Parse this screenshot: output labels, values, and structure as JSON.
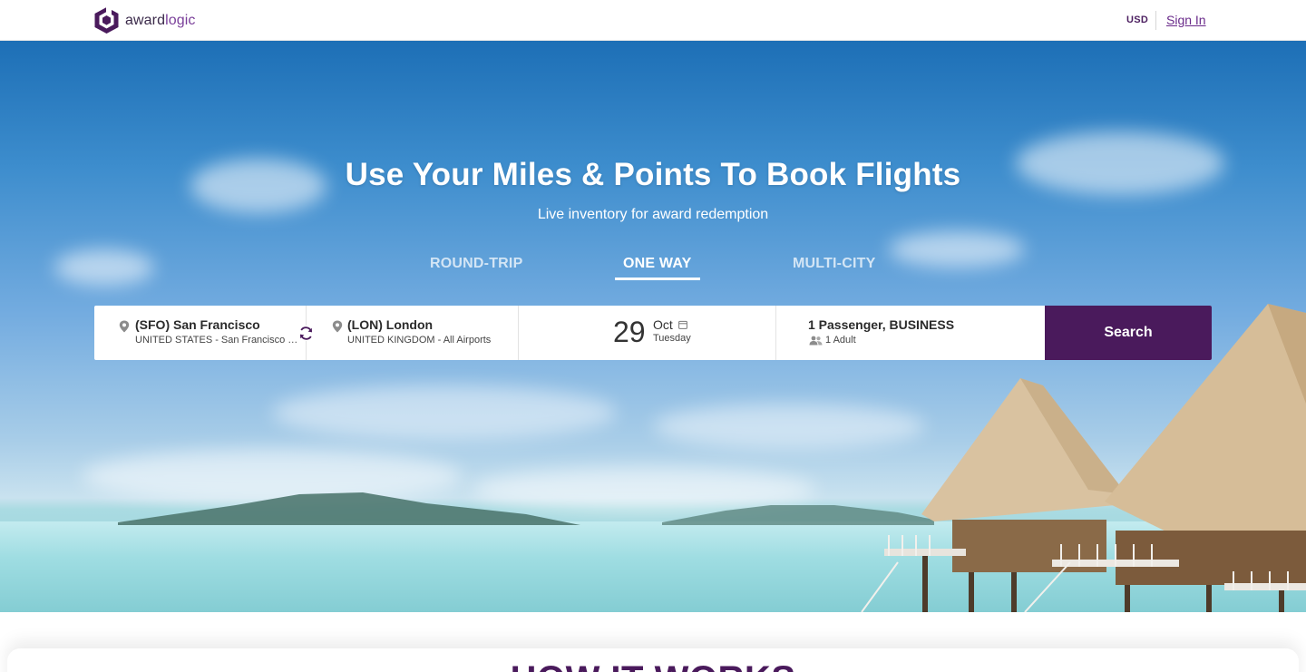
{
  "header": {
    "brand": {
      "part1": "award",
      "part2": "logic"
    },
    "currency": "USD",
    "signin": "Sign In"
  },
  "hero": {
    "title": "Use Your Miles & Points To Book Flights",
    "subtitle": "Live inventory for award redemption",
    "tabs": [
      {
        "label": "ROUND-TRIP",
        "active": false
      },
      {
        "label": "ONE WAY",
        "active": true
      },
      {
        "label": "MULTI-CITY",
        "active": false
      }
    ]
  },
  "search": {
    "from": {
      "code_city": "(SFO) San Francisco",
      "detail": "UNITED STATES - San Francisco In..."
    },
    "to": {
      "code_city": "(LON) London",
      "detail": "UNITED KINGDOM - All Airports"
    },
    "date": {
      "day": "29",
      "month": "Oct",
      "weekday": "Tuesday"
    },
    "passengers": {
      "summary": "1 Passenger, BUSINESS",
      "detail": "1 Adult"
    },
    "button": "Search"
  },
  "section": {
    "title": "HOW IT WORKS"
  },
  "colors": {
    "brand": "#4a1a5c",
    "accent": "#7a3f9a"
  },
  "icons": [
    "logo-mark",
    "map-pin-icon",
    "swap-icon",
    "calendar-icon",
    "people-icon"
  ]
}
